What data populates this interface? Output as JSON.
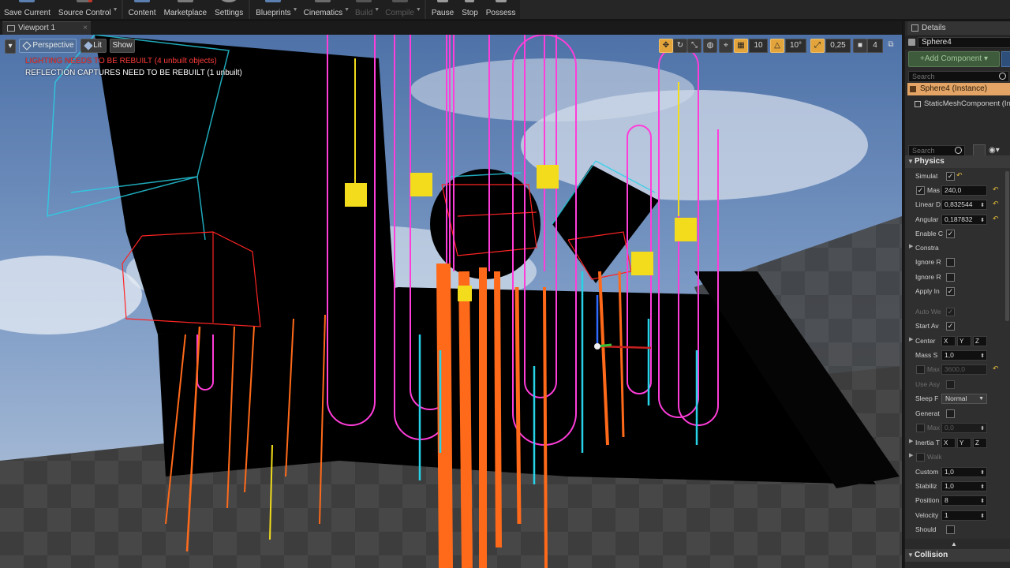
{
  "toolbar": {
    "buttons": [
      {
        "label": "Save Current",
        "color": "#5b7fb0"
      },
      {
        "label": "Source Control",
        "color": "#6b6b6b"
      },
      {
        "label": "Content",
        "color": "#5b7fb0"
      },
      {
        "label": "Marketplace",
        "color": "#7b7b7b"
      },
      {
        "label": "Settings",
        "color": "#8a8a8a"
      },
      {
        "label": "Blueprints",
        "color": "#5b7fb0"
      },
      {
        "label": "Cinematics",
        "color": "#6b6b6b"
      },
      {
        "label": "Build",
        "color": "#555555"
      },
      {
        "label": "Compile",
        "color": "#555555"
      },
      {
        "label": "Pause",
        "color": "#9a9a9a"
      },
      {
        "label": "Stop",
        "color": "#9a9a9a"
      },
      {
        "label": "Possess",
        "color": "#9a9a9a"
      }
    ]
  },
  "viewport": {
    "tab_label": "Viewport 1",
    "perspective_label": "Perspective",
    "lit_label": "Lit",
    "show_label": "Show",
    "snap_grid": "10",
    "snap_rotation": "10°",
    "snap_scale": "0,25",
    "camera_speed": "4",
    "lighting_warning": "LIGHTING NEEDS TO BE REBUILT (4 unbuilt objects)",
    "reflection_warning": "REFLECTION CAPTURES NEED TO BE REBUILT (1 unbuilt)"
  },
  "details": {
    "tab_label": "Details",
    "object_name": "Sphere4",
    "add_component_label": "+Add Component",
    "search_placeholder": "Search",
    "component_instance": "Sphere4 (Instance)",
    "component_mesh": "StaticMeshComponent (In",
    "search2_placeholder": "Search",
    "physics_header": "Physics",
    "props": {
      "simulate": "Simulat",
      "mass_label": "Mas",
      "mass_value": "240,0",
      "linear_damping": "Linear D",
      "linear_damping_value": "0,832544",
      "angular_damping": "Angular",
      "angular_damping_value": "0,187832",
      "enable_gravity": "Enable C",
      "constraints": "Constra",
      "ignore_radial_impulse": "Ignore R",
      "ignore_radial_force": "Ignore R",
      "apply_impulse": "Apply In",
      "auto_weld": "Auto We",
      "start_awake": "Start Av",
      "center_of_mass": "Center",
      "mass_scale": "Mass S",
      "mass_scale_value": "1,0",
      "max_angular_velocity": "Max",
      "max_angular_velocity_value": "3600,0",
      "use_async": "Use Asy",
      "sleep_family": "Sleep F",
      "sleep_family_value": "Normal",
      "generate_wake_events": "Generat",
      "max_depenetration": "Max",
      "max_depenetration_value": "0,0",
      "inertia_tensor": "Inertia T",
      "walkable": "Walk",
      "custom_sleep": "Custom",
      "custom_sleep_value": "1,0",
      "stabilization": "Stabiliz",
      "stabilization_value": "1,0",
      "position_solver": "Position",
      "position_solver_value": "8",
      "velocity_solver": "Velocity",
      "velocity_solver_value": "1",
      "should_update": "Should",
      "x": "X",
      "y": "Y",
      "z": "Z"
    },
    "collision_header": "Collision"
  }
}
